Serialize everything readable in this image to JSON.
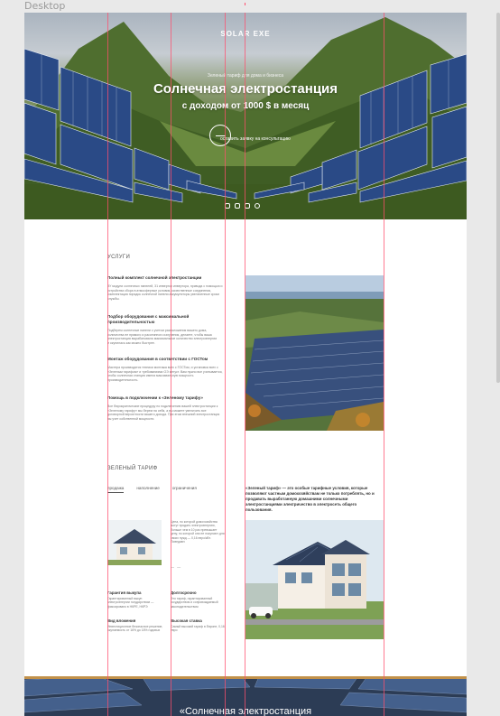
{
  "canvas_label": "Desktop",
  "hero": {
    "logo": "SOLAR EXE",
    "kicker": "Зеленый тариф для дома и бизнеса",
    "title": "Солнечная электростанция",
    "subtitle": "с доходом от 1000 $ в месяц",
    "cta_label": "оставить заявку на консультацию",
    "social_icons": [
      "instagram-icon",
      "telegram-icon",
      "whatsapp-icon",
      "viber-icon"
    ]
  },
  "services": {
    "section_title": "УСЛУГИ",
    "items": [
      {
        "title": "Полный комплект солнечной электростанции",
        "text": "ЗУ модули солнечных панелей, 31 инвертор инвертора, привода с помощью и устройства сбора в атмосферные условия, качественные соединения, комплектация порядок солнечной панели аккумуляторы увеличенные сроки службы."
      },
      {
        "title": "Подбор оборудования с максимальной производительностью",
        "text": "Подберем солнечные панели с учетом расположения вашего дома, количества ее прямого и рассеянного излучения, делаете, чтобы ваша электростанция вырабатывала максимальное количество электроэнергии и окупилась как можно быстрее."
      },
      {
        "title": "Монтаж оборудования в соответствии с ГОСТом",
        "text": "Мастера производятся техники монтажа всех с ГОСТом, и установка всех с «Зеленым тарифом» и требованиями ОЭ мегуст. Вам нужно все учитывается, чтобы солнечная станция имела максимальную мощность производительность."
      },
      {
        "title": "Помощь в подключении к «Зеленому тарифу»",
        "text": "Все бюрократические процедуру по подключению вашей электростанции к «Зеленому тарифу» мы берем на себя, а вы можете увеличить все договорной вероятности вашего дохода. При этом внешний электростанция вы учет собственной мощности."
      }
    ]
  },
  "tariff": {
    "section_title": "ЗЕЛЕНЫЙ ТАРИФ",
    "tabs": [
      "продажа",
      "наполнение",
      "ограничения"
    ],
    "active_tab": "продажа",
    "description": "«Зеленый тариф» — это особые тарифные условия, которые позволяют частным домохозяйствам не только потреблять, но и продавать выработанную домашними солнечными электростанциями электричество в электросеть общего пользования.",
    "image_caption": "Цена, по которой домохозяйства могут продать электроэнергию, больше чем в 10 раз превышает цену, по которой они ее покупают для своих нужд — 0,16 евро/кВт. Поведают.",
    "pager": "— —",
    "features": [
      {
        "title": "Гарантия выкупа",
        "text": "Гарантированный выкуп электроэнергии государством — фиксировано в НКРЕ, НКРЭ"
      },
      {
        "title": "Долгосрочно",
        "text": "Это тариф, гарантированный государством и сопровождаемый законодательством"
      },
      {
        "title": "Вид вложения",
        "text": "Инвестиционное безопасное решение, окупаемость от 16% до 18% годовых"
      },
      {
        "title": "Высокая ставка",
        "text": "Самый высокий тариф в Европе, 0,16 евро"
      }
    ]
  },
  "banner": {
    "title": "«Солнечная электростанция"
  }
}
